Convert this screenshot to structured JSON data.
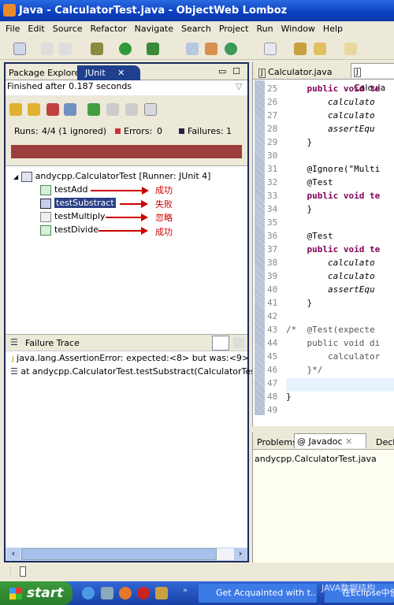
{
  "window": {
    "title": "Java - CalculatorTest.java - ObjectWeb Lomboz"
  },
  "menu": [
    "File",
    "Edit",
    "Source",
    "Refactor",
    "Navigate",
    "Search",
    "Project",
    "Run",
    "Window",
    "Help"
  ],
  "left": {
    "tabs": [
      "Package Explorer",
      "JUnit"
    ],
    "status": "Finished after 0.187 seconds",
    "runs_label": "Runs:",
    "runs": "4/4 (1 ignored)",
    "errors_label": "Errors:",
    "errors": "0",
    "failures_label": "Failures:",
    "failures": "1",
    "bar_color": "#9c3c3c",
    "suite": "andycpp.CalculatorTest [Runner: JUnit 4]",
    "tests": [
      {
        "name": "testAdd",
        "note": "成功",
        "status": "pass"
      },
      {
        "name": "testSubstract",
        "note": "失败",
        "status": "fail"
      },
      {
        "name": "testMultiply",
        "note": "忽略",
        "status": "ignored"
      },
      {
        "name": "testDivide",
        "note": "成功",
        "status": "pass"
      }
    ],
    "failure_trace_title": "Failure Trace",
    "trace": [
      "java.lang.AssertionError: expected:<8> but was:<9>",
      "at andycpp.CalculatorTest.testSubstract(CalculatorTest.ja"
    ]
  },
  "editor": {
    "tabs": [
      "Calculator.java",
      "Calcula"
    ],
    "lines": [
      {
        "n": "25",
        "t": "    public void te",
        "kw": true
      },
      {
        "n": "26",
        "t": "        calculato",
        "it": true
      },
      {
        "n": "27",
        "t": "        calculato",
        "it": true
      },
      {
        "n": "28",
        "t": "        assertEqu",
        "it": true
      },
      {
        "n": "29",
        "t": "    }"
      },
      {
        "n": "30",
        "t": ""
      },
      {
        "n": "31",
        "t": "    @Ignore(\"Multi"
      },
      {
        "n": "32",
        "t": "    @Test"
      },
      {
        "n": "33",
        "t": "    public void te",
        "kw": true
      },
      {
        "n": "34",
        "t": "    }"
      },
      {
        "n": "35",
        "t": ""
      },
      {
        "n": "36",
        "t": "    @Test"
      },
      {
        "n": "37",
        "t": "    public void te",
        "kw": true
      },
      {
        "n": "38",
        "t": "        calculato",
        "it": true
      },
      {
        "n": "39",
        "t": "        calculato",
        "it": true
      },
      {
        "n": "40",
        "t": "        assertEqu",
        "it": true
      },
      {
        "n": "41",
        "t": "    }"
      },
      {
        "n": "42",
        "t": ""
      },
      {
        "n": "43",
        "t": "/*  @Test(expecte"
      },
      {
        "n": "44",
        "t": "    public void di"
      },
      {
        "n": "45",
        "t": "        calculator"
      },
      {
        "n": "46",
        "t": "    }*/"
      },
      {
        "n": "47",
        "t": ""
      },
      {
        "n": "48",
        "t": "}"
      },
      {
        "n": "49",
        "t": ""
      }
    ]
  },
  "bottom": {
    "tabs": [
      "Problems",
      "Javadoc",
      "Decla"
    ],
    "content": "andycpp.CalculatorTest.java"
  },
  "taskbar": {
    "start": "start",
    "tasks": [
      "Get Acquainted with t...",
      "在Eclipse中使"
    ],
    "watermark": "JAVA数据结构"
  }
}
